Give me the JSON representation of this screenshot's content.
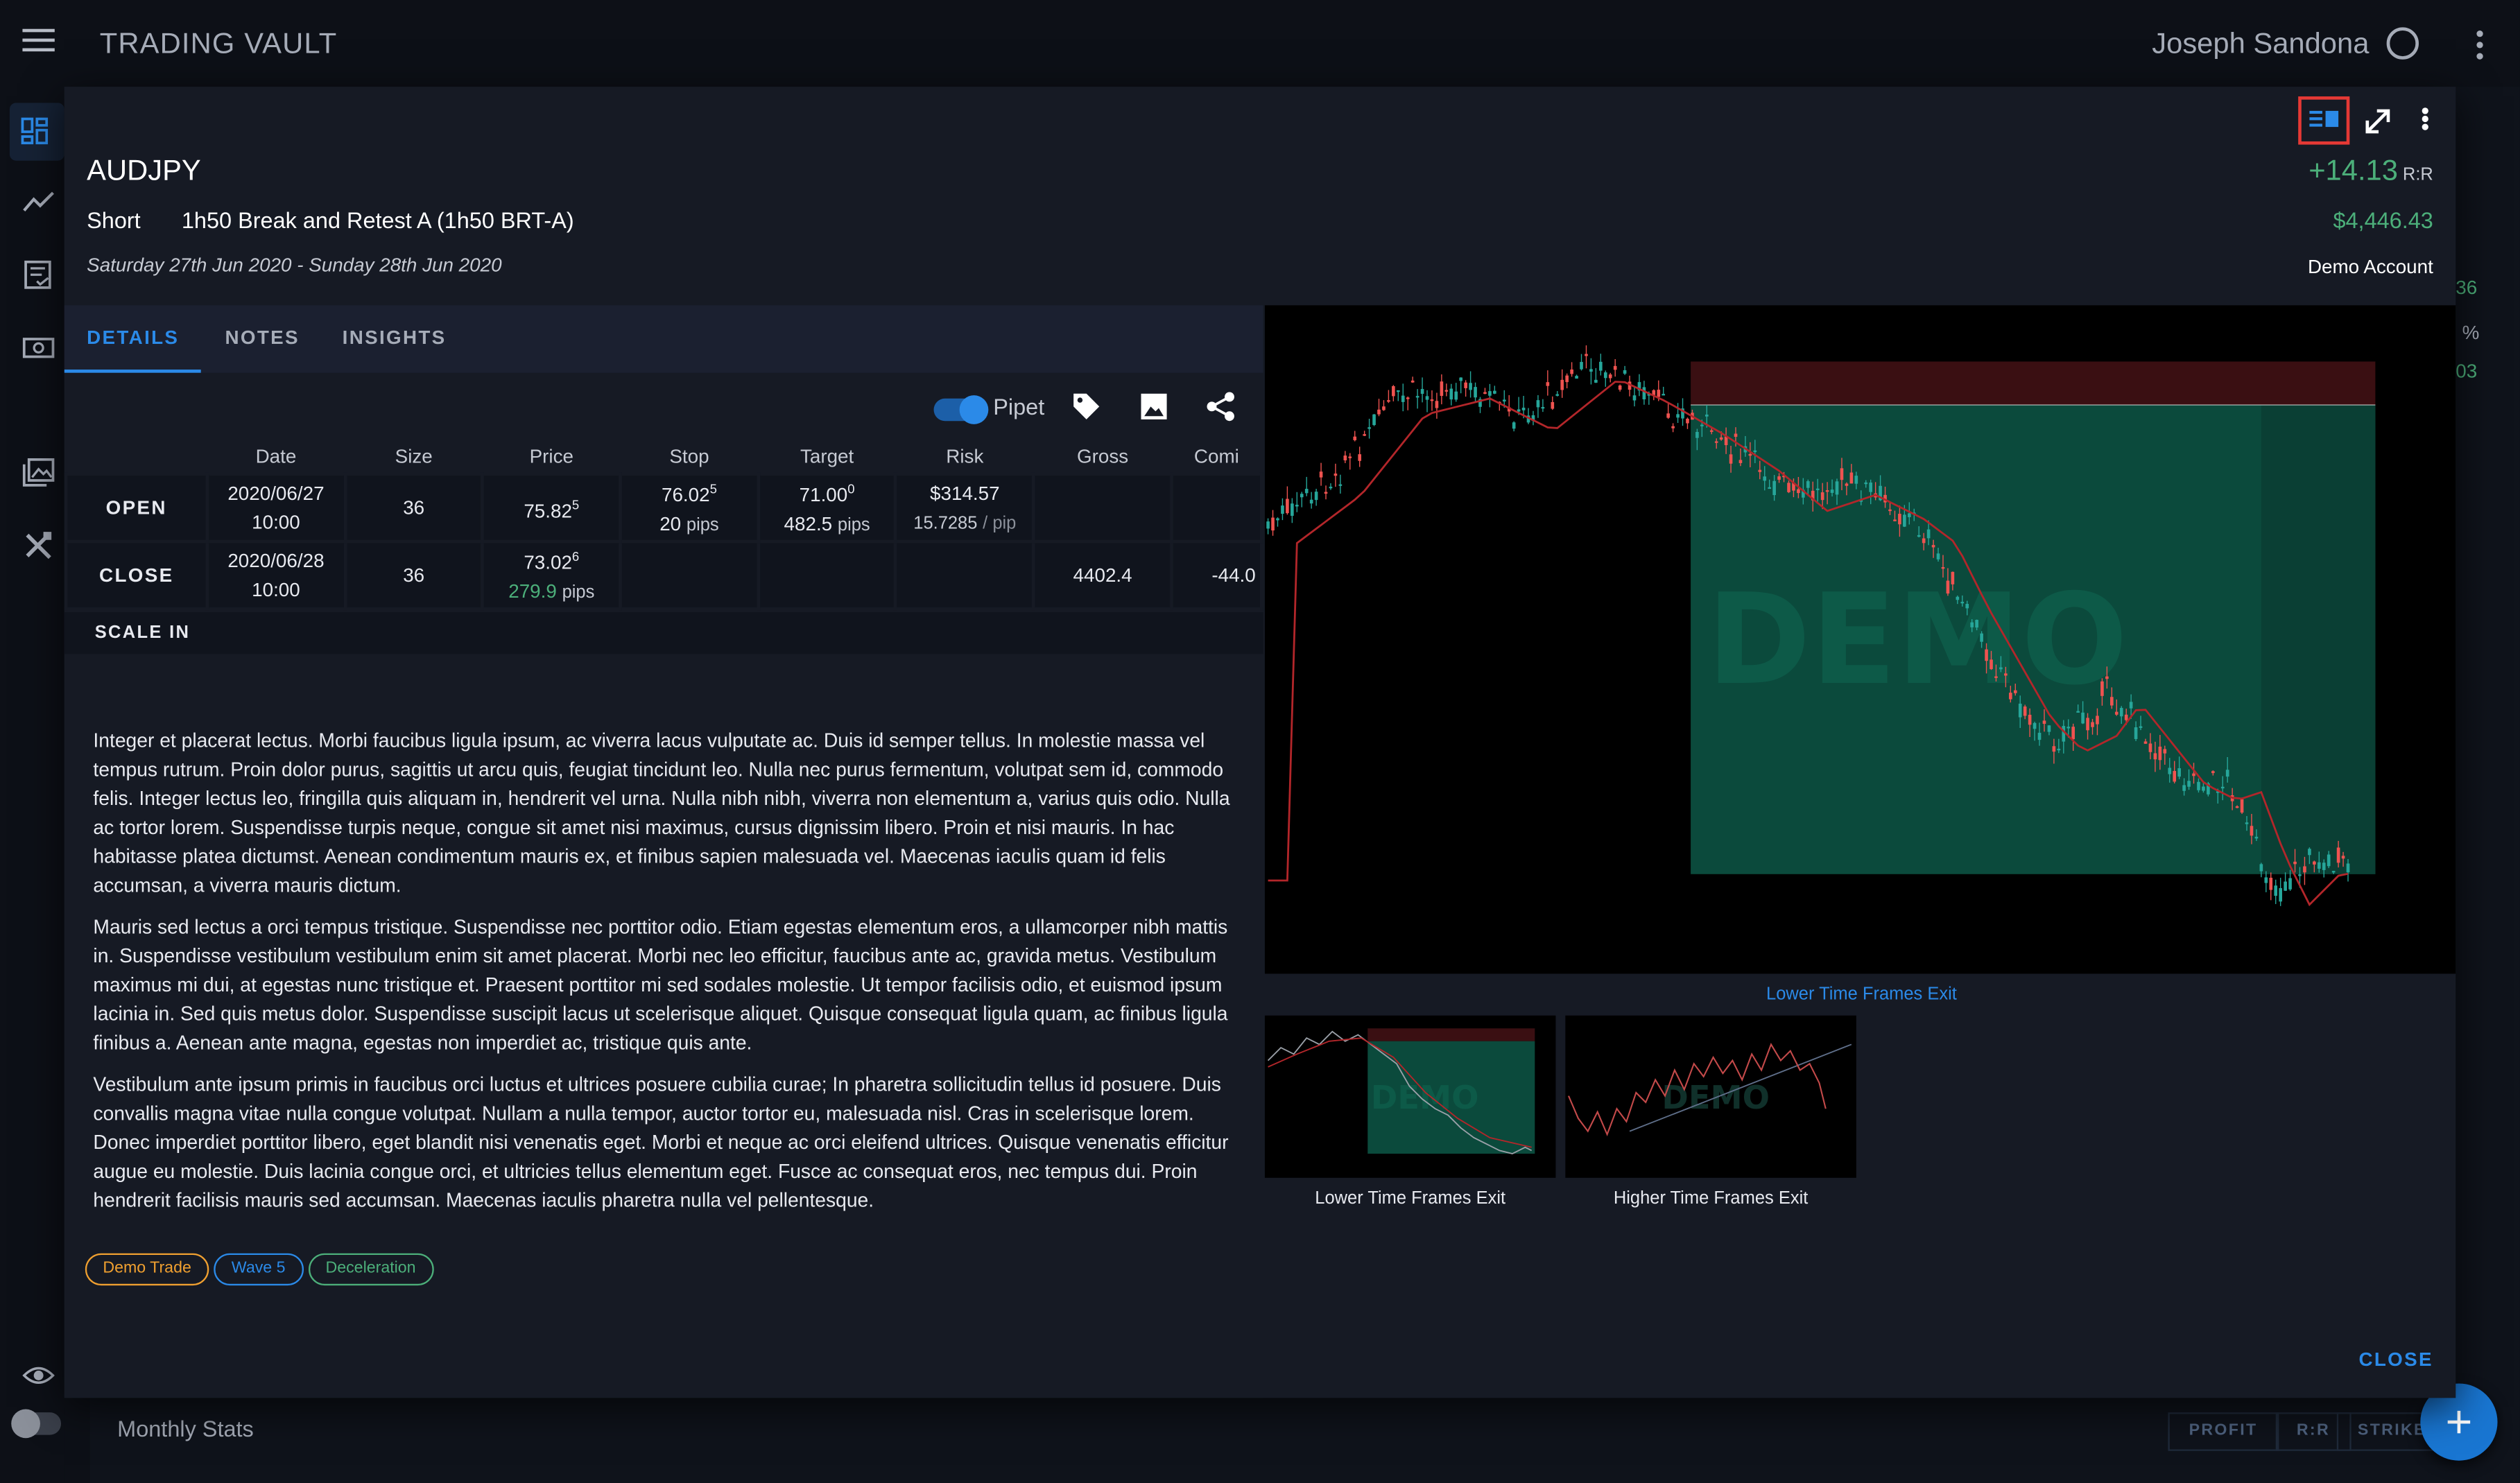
{
  "app": {
    "title": "TRADING VAULT",
    "user_name": "Joseph Sandona"
  },
  "sidebar": {
    "items": [
      {
        "icon": "dashboard-icon",
        "active": true
      },
      {
        "icon": "trend-line-icon",
        "active": false
      },
      {
        "icon": "journal-check-icon",
        "active": false
      },
      {
        "icon": "cash-icon",
        "active": false
      },
      {
        "icon": "photo-library-icon",
        "active": false
      },
      {
        "icon": "tools-icon",
        "active": false
      }
    ],
    "bottom": [
      {
        "icon": "eye-icon"
      },
      {
        "icon": "toggle-switch"
      }
    ]
  },
  "background": {
    "monthly_stats": "Monthly Stats",
    "segments": [
      "PROFIT",
      "R:R",
      "STRIKE"
    ],
    "right_values": [
      "36",
      "%",
      "03"
    ]
  },
  "trade": {
    "pair": "AUDJPY",
    "direction": "Short",
    "setup": "1h50 Break and Retest A (1h50 BRT-A)",
    "dates": "Saturday 27th Jun 2020 - Sunday 28th Jun 2020",
    "rr_value": "+14.13",
    "rr_unit": "R:R",
    "profit": "$4,446.43",
    "account": "Demo Account"
  },
  "header_buttons": [
    "split-view-icon",
    "expand-icon",
    "more-vert-icon"
  ],
  "tabs": [
    {
      "label": "DETAILS",
      "active": true
    },
    {
      "label": "NOTES",
      "active": false
    },
    {
      "label": "INSIGHTS",
      "active": false
    }
  ],
  "toolbar": {
    "toggle_label": "Pipet",
    "toggle_on": true,
    "icons": [
      "tag-icon",
      "image-icon",
      "share-icon"
    ]
  },
  "table": {
    "headers": [
      "Date",
      "Size",
      "Price",
      "Stop",
      "Target",
      "Risk",
      "Gross",
      "Comi"
    ],
    "open": {
      "label": "OPEN",
      "date": "2020/06/27",
      "time": "10:00",
      "size": "36",
      "price": "75.82",
      "price_pipet": "5",
      "stop": "76.02",
      "stop_pipet": "5",
      "stop_pips": "20",
      "target": "71.00",
      "target_pipet": "0",
      "target_pips": "482.5",
      "risk": "$314.57",
      "risk_per_pip": "15.7285",
      "risk_unit": "/ pip",
      "pips_unit": "pips"
    },
    "close": {
      "label": "CLOSE",
      "date": "2020/06/28",
      "time": "10:00",
      "size": "36",
      "price": "73.02",
      "price_pipet": "6",
      "price_pips": "279.9",
      "pips_unit": "pips",
      "gross": "4402.4",
      "commission": "-44.0"
    },
    "scale_in": "SCALE IN"
  },
  "notes": [
    "Integer et placerat lectus. Morbi faucibus ligula ipsum, ac viverra lacus vulputate ac. Duis id semper tellus. In molestie massa vel tempus rutrum. Proin dolor purus, sagittis ut arcu quis, feugiat tincidunt leo. Nulla nec purus fermentum, volutpat sem id, commodo felis. Integer lectus leo, fringilla quis aliquam in, hendrerit vel urna. Nulla nibh nibh, viverra non elementum a, varius quis odio. Nulla ac tortor lorem. Suspendisse turpis neque, congue sit amet nisi maximus, cursus dignissim libero. Proin et nisi mauris. In hac habitasse platea dictumst. Aenean condimentum mauris ex, et finibus sapien malesuada vel. Maecenas iaculis quam id felis accumsan, a viverra mauris dictum.",
    "Mauris sed lectus a orci tempus tristique. Suspendisse nec porttitor odio. Etiam egestas elementum eros, a ullamcorper nibh mattis in. Suspendisse vestibulum vestibulum enim sit amet placerat. Morbi nec leo efficitur, faucibus ante ac, gravida metus. Vestibulum maximus mi dui, at egestas nunc tristique et. Praesent porttitor mi sed sodales molestie. Ut tempor facilisis odio, et euismod ipsum lacinia in. Sed quis metus dolor. Suspendisse suscipit lacus ut scelerisque aliquet. Quisque consequat ligula quam, ac finibus ligula finibus a. Aenean ante magna, egestas non imperdiet ac, tristique quis ante.",
    "Vestibulum ante ipsum primis in faucibus orci luctus et ultrices posuere cubilia curae; In pharetra sollicitudin tellus id posuere. Duis convallis magna vitae nulla congue volutpat. Nullam a nulla tempor, auctor tortor eu, malesuada nisl. Cras in scelerisque lorem. Donec imperdiet porttitor libero, eget blandit nisi venenatis eget. Morbi et neque ac orci eleifend ultrices. Quisque venenatis efficitur augue eu molestie. Duis lacinia congue orci, et ultricies tellus elementum eget. Fusce ac consequat eros, nec tempus dui. Proin hendrerit facilisis mauris sed accumsan. Maecenas iaculis pharetra nulla vel pellentesque."
  ],
  "tags": [
    {
      "label": "Demo Trade",
      "color": "#f0a030"
    },
    {
      "label": "Wave 5",
      "color": "#2b8ae8"
    },
    {
      "label": "Deceleration",
      "color": "#4caf7a"
    }
  ],
  "images": {
    "main_caption": "Lower Time Frames Exit",
    "watermark": "DEMO",
    "thumbs": [
      {
        "caption": "Lower Time Frames Exit"
      },
      {
        "caption": "Higher Time Frames Exit"
      }
    ]
  },
  "footer": {
    "close_label": "CLOSE"
  },
  "colors": {
    "accent": "#2b8ae8",
    "profit_green": "#4caf7a",
    "loss_zone": "#3a0f12",
    "profit_zone": "#0b4a3c"
  }
}
